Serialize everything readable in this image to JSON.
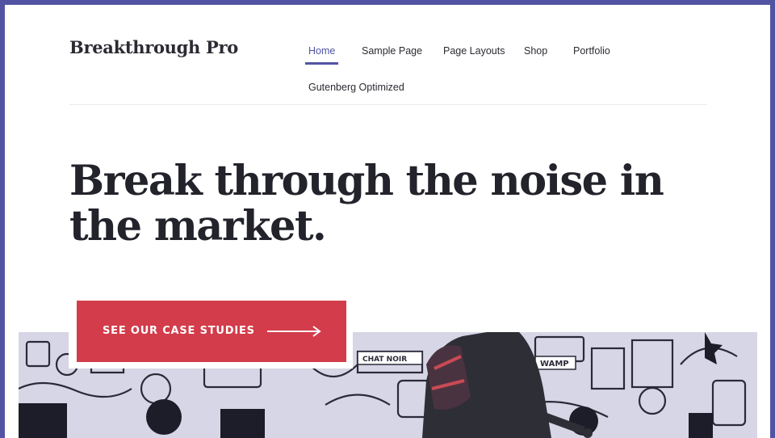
{
  "header": {
    "site_title": "Breakthrough Pro",
    "nav": [
      {
        "label": "Home",
        "active": true
      },
      {
        "label": "Sample Page"
      },
      {
        "label": "Page Layouts"
      },
      {
        "label": "Shop"
      },
      {
        "label": "Portfolio"
      },
      {
        "label": "Gutenberg Optimized"
      }
    ]
  },
  "hero": {
    "headline": "Break through the noise in the market.",
    "cta_label": "SEE OUR CASE STUDIES",
    "image_signs": [
      "CHAT NOIR",
      "WAMP"
    ]
  },
  "colors": {
    "frame": "#5254a3",
    "accent": "#5254a3",
    "cta": "#d33c4a",
    "text": "#23232c"
  },
  "icons": {
    "cta": "arrow-right-icon"
  }
}
